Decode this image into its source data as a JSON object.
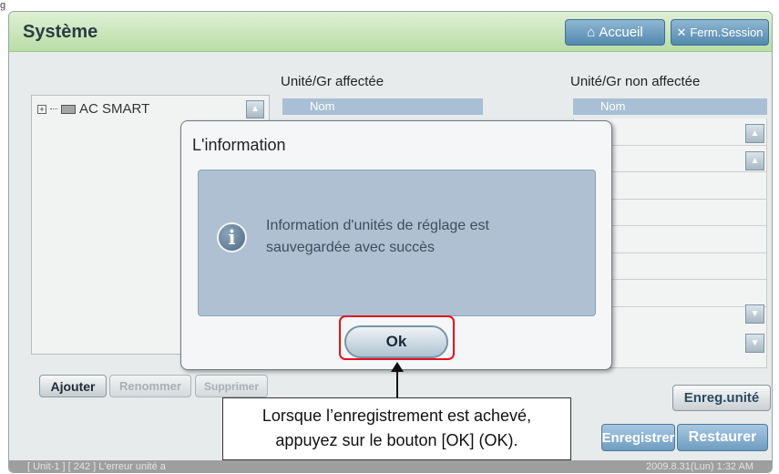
{
  "figure_label": "g",
  "header": {
    "title": "Système",
    "home_label": "Accueil",
    "logout_label": "Ferm.Session"
  },
  "tree": {
    "item": "AC SMART"
  },
  "assigned": {
    "label": "Unité/Gr affectée",
    "column": "Nom"
  },
  "unassigned": {
    "label": "Unité/Gr non affectée",
    "column": "Nom"
  },
  "buttons": {
    "add": "Ajouter",
    "rename": "Renommer",
    "delete": "Supprimer",
    "save_unit": "Enreg.unité",
    "save": "Enregistrer",
    "restore": "Restaurer"
  },
  "dialog": {
    "title": "L'information",
    "message_line1": "Information d'unités de réglage est",
    "message_line2": "sauvegardée avec succès",
    "ok_label": "Ok"
  },
  "status": {
    "left": "[ Unit-1 ] [ 242 ] L'erreur unité a",
    "right": "2009.8.31(Lun)  1:32 AM"
  },
  "callout": {
    "line1": "Lorsque l’enregistrement est achevé,",
    "line2": "appuyez sur le bouton [OK] (OK)."
  }
}
